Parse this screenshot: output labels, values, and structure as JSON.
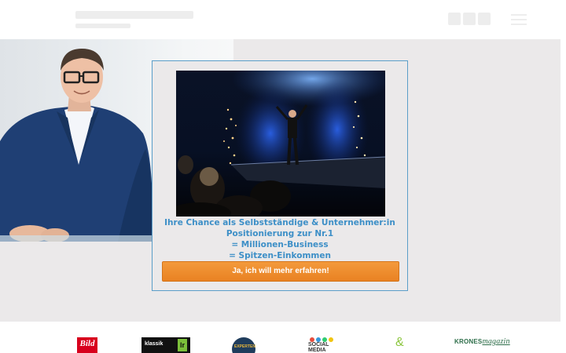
{
  "popup": {
    "lines": [
      "Ihre Chance als Selbstständige & Unternehmer:in",
      "Positionierung zur Nr.1",
      "= Millionen-Business",
      "= Spitzen-Einkommen"
    ],
    "cta_label": "Ja, ich will mehr erfahren!"
  },
  "press_logos": {
    "bild": "Bild",
    "klassik": "klassik",
    "klassik_mark": "lr",
    "experten": "EXPERTEN",
    "social_media": "SOCIAL MEDIA",
    "krones_a": "KRONES",
    "krones_b": "magazin"
  },
  "colors": {
    "accent_text": "#3d8fc7",
    "cta": "#ef8a2c",
    "popup_border": "#5b9ec9",
    "hero_bg": "#ebe9ea"
  },
  "icons": [
    "site-logo",
    "social-icons",
    "menu-icon"
  ]
}
